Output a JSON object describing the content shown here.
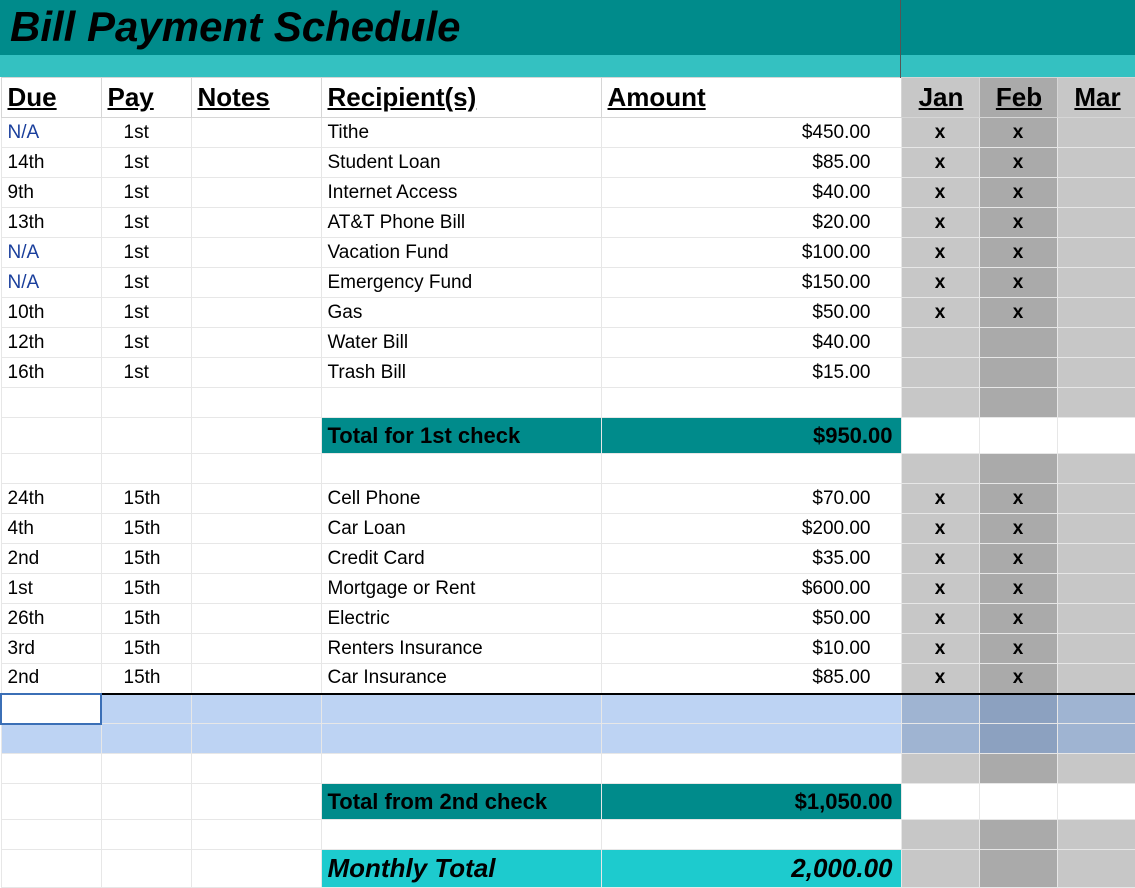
{
  "title": "Bill Payment Schedule",
  "headers": {
    "due": "Due",
    "pay": "Pay",
    "notes": "Notes",
    "recipient": "Recipient(s)",
    "amount": "Amount",
    "months": [
      "Jan",
      "Feb",
      "Mar"
    ]
  },
  "group1": [
    {
      "due": "N/A",
      "due_na": true,
      "pay": "1st",
      "notes": "",
      "recipient": "Tithe",
      "amount": "$450.00",
      "jan": "x",
      "feb": "x",
      "mar": ""
    },
    {
      "due": "14th",
      "due_na": false,
      "pay": "1st",
      "notes": "",
      "recipient": "Student Loan",
      "amount": "$85.00",
      "jan": "x",
      "feb": "x",
      "mar": ""
    },
    {
      "due": "9th",
      "due_na": false,
      "pay": "1st",
      "notes": "",
      "recipient": "Internet Access",
      "amount": "$40.00",
      "jan": "x",
      "feb": "x",
      "mar": ""
    },
    {
      "due": "13th",
      "due_na": false,
      "pay": "1st",
      "notes": "",
      "recipient": "AT&T Phone Bill",
      "amount": "$20.00",
      "jan": "x",
      "feb": "x",
      "mar": ""
    },
    {
      "due": "N/A",
      "due_na": true,
      "pay": "1st",
      "notes": "",
      "recipient": "Vacation Fund",
      "amount": "$100.00",
      "jan": "x",
      "feb": "x",
      "mar": ""
    },
    {
      "due": "N/A",
      "due_na": true,
      "pay": "1st",
      "notes": "",
      "recipient": "Emergency Fund",
      "amount": "$150.00",
      "jan": "x",
      "feb": "x",
      "mar": ""
    },
    {
      "due": "10th",
      "due_na": false,
      "pay": "1st",
      "notes": "",
      "recipient": "Gas",
      "amount": "$50.00",
      "jan": "x",
      "feb": "x",
      "mar": ""
    },
    {
      "due": "12th",
      "due_na": false,
      "pay": "1st",
      "notes": "",
      "recipient": "Water Bill",
      "amount": "$40.00",
      "jan": "",
      "feb": "",
      "mar": ""
    },
    {
      "due": "16th",
      "due_na": false,
      "pay": "1st",
      "notes": "",
      "recipient": "Trash Bill",
      "amount": "$15.00",
      "jan": "",
      "feb": "",
      "mar": ""
    }
  ],
  "subtotal1": {
    "label": "Total for 1st check",
    "amount": "$950.00"
  },
  "group2": [
    {
      "due": "24th",
      "due_na": false,
      "pay": "15th",
      "notes": "",
      "recipient": "Cell Phone",
      "amount": "$70.00",
      "jan": "x",
      "feb": "x",
      "mar": ""
    },
    {
      "due": "4th",
      "due_na": false,
      "pay": "15th",
      "notes": "",
      "recipient": "Car Loan",
      "amount": "$200.00",
      "jan": "x",
      "feb": "x",
      "mar": ""
    },
    {
      "due": "2nd",
      "due_na": false,
      "pay": "15th",
      "notes": "",
      "recipient": "Credit Card",
      "amount": "$35.00",
      "jan": "x",
      "feb": "x",
      "mar": ""
    },
    {
      "due": "1st",
      "due_na": false,
      "pay": "15th",
      "notes": "",
      "recipient": "Mortgage or Rent",
      "amount": "$600.00",
      "jan": "x",
      "feb": "x",
      "mar": ""
    },
    {
      "due": "26th",
      "due_na": false,
      "pay": "15th",
      "notes": "",
      "recipient": "Electric",
      "amount": "$50.00",
      "jan": "x",
      "feb": "x",
      "mar": ""
    },
    {
      "due": "3rd",
      "due_na": false,
      "pay": "15th",
      "notes": "",
      "recipient": "Renters Insurance",
      "amount": "$10.00",
      "jan": "x",
      "feb": "x",
      "mar": ""
    },
    {
      "due": "2nd",
      "due_na": false,
      "pay": "15th",
      "notes": "",
      "recipient": "Car Insurance",
      "amount": "$85.00",
      "jan": "x",
      "feb": "x",
      "mar": ""
    }
  ],
  "subtotal2": {
    "label": "Total from 2nd check",
    "amount": "$1,050.00"
  },
  "monthly_total": {
    "label": "Monthly Total",
    "amount": "2,000.00"
  }
}
